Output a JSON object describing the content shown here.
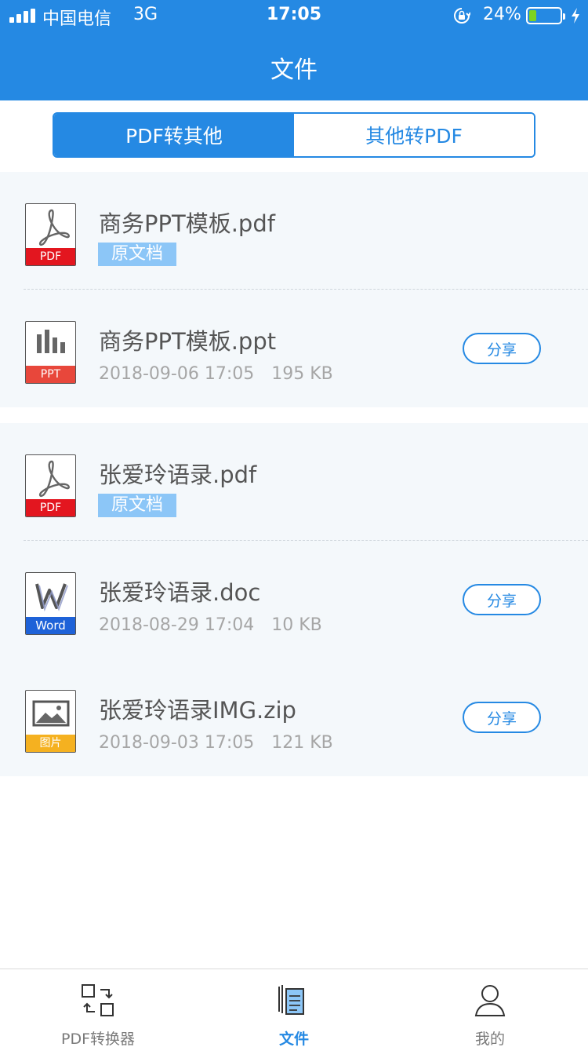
{
  "status_bar": {
    "carrier": "中国电信",
    "network": "3G",
    "time": "17:05",
    "battery_percent": "24%",
    "battery_level": 0.24,
    "icons": [
      "signal-icon",
      "orientation-lock-icon",
      "battery-icon",
      "charging-bolt-icon"
    ]
  },
  "nav": {
    "title": "文件"
  },
  "segment": {
    "active": "PDF转其他",
    "inactive": "其他转PDF"
  },
  "groups": [
    {
      "items": [
        {
          "name": "商务PPT模板.pdf",
          "type": "PDF",
          "tag": "原文档"
        },
        {
          "name": "商务PPT模板.ppt",
          "type": "PPT",
          "date": "2018-09-06 17:05",
          "size": "195 KB",
          "action": "分享"
        }
      ]
    },
    {
      "items": [
        {
          "name": "张爱玲语录.pdf",
          "type": "PDF",
          "tag": "原文档"
        },
        {
          "name": "张爱玲语录.doc",
          "type": "Word",
          "date": "2018-08-29 17:04",
          "size": "10 KB",
          "action": "分享"
        },
        {
          "name": "张爱玲语录IMG.zip",
          "type": "图片",
          "date": "2018-09-03 17:05",
          "size": "121 KB",
          "action": "分享"
        }
      ]
    }
  ],
  "tabbar": {
    "tabs": [
      {
        "label": "PDF转换器",
        "icon": "convert-icon"
      },
      {
        "label": "文件",
        "icon": "files-icon",
        "active": true
      },
      {
        "label": "我的",
        "icon": "profile-icon"
      }
    ]
  },
  "colors": {
    "accent": "#2589e3",
    "pdf_red": "#e3161f",
    "word_blue": "#1e62d8",
    "image_yellow": "#f5b120",
    "tag_blue": "#8cc6f7"
  }
}
